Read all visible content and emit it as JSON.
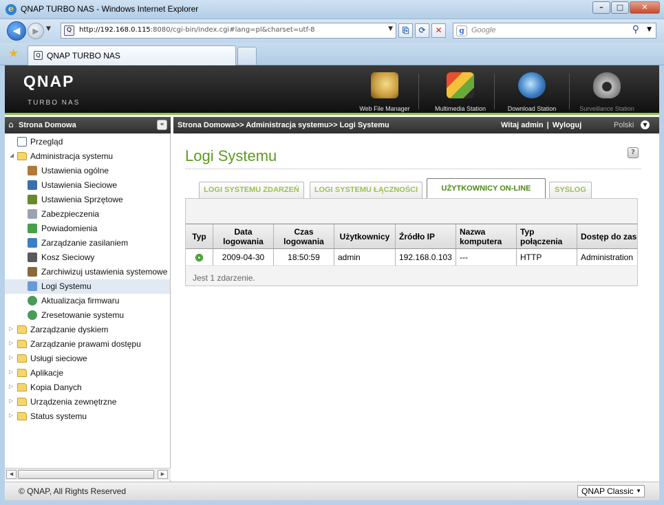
{
  "window": {
    "title": "QNAP TURBO NAS - Windows Internet Explorer"
  },
  "address": {
    "url_host": "http://192.168.0.115",
    "url_rest": ":8080/cgi-bin/index.cgi#lang=pl&charset=utf-8"
  },
  "search": {
    "placeholder": "Google"
  },
  "tabs": [
    {
      "label": "QNAP TURBO NAS"
    }
  ],
  "header": {
    "logo": "QNAP",
    "logo_sub": "TURBO NAS",
    "apps": [
      {
        "label": "Web File Manager",
        "icon": "web-file-manager-icon",
        "color": "#c89a3c"
      },
      {
        "label": "Multimedia Station",
        "icon": "multimedia-station-icon",
        "color": "#7a9e3a"
      },
      {
        "label": "Download Station",
        "icon": "download-station-icon",
        "color": "#3c7fc4"
      },
      {
        "label": "Surveillance Station",
        "icon": "surveillance-station-icon",
        "color": "#9a9a9a"
      }
    ]
  },
  "sidebar": {
    "title": "Strona Domowa",
    "items": [
      {
        "label": "Przegląd"
      },
      {
        "label": "Administracja systemu"
      },
      {
        "label": "Ustawienia ogólne"
      },
      {
        "label": "Ustawienia Sieciowe"
      },
      {
        "label": "Ustawienia Sprzętowe"
      },
      {
        "label": "Zabezpieczenia"
      },
      {
        "label": "Powiadomienia"
      },
      {
        "label": "Zarządzanie zasilaniem"
      },
      {
        "label": "Kosz Sieciowy"
      },
      {
        "label": "Zarchiwizuj ustawienia systemowe"
      },
      {
        "label": "Logi Systemu"
      },
      {
        "label": "Aktualizacja firmwaru"
      },
      {
        "label": "Zresetowanie systemu"
      },
      {
        "label": "Zarządzanie dyskiem"
      },
      {
        "label": "Zarządzanie prawami dostępu"
      },
      {
        "label": "Usługi sieciowe"
      },
      {
        "label": "Aplikacje"
      },
      {
        "label": "Kopia Danych"
      },
      {
        "label": "Urządzenia zewnętrzne"
      },
      {
        "label": "Status systemu"
      }
    ]
  },
  "crumb": {
    "path": "Strona Domowa>> Administracja systemu>> Logi Systemu",
    "welcome": "Witaj admin",
    "logout": "Wyloguj",
    "language": "Polski"
  },
  "main": {
    "title": "Logi Systemu",
    "help": "?",
    "tabs": [
      {
        "label": "LOGI SYSTEMU ZDARZEŃ"
      },
      {
        "label": "LOGI SYSTEMU ŁĄCZNOŚCI"
      },
      {
        "label": "UŻYTKOWNICY ON-LINE"
      },
      {
        "label": "SYSLOG"
      }
    ],
    "columns": [
      "Typ",
      "Data logowania",
      "Czas logowania",
      "Użytkownicy",
      "Źródło IP",
      "Nazwa komputera",
      "Typ połączenia",
      "Dostęp do zasobów"
    ],
    "rows": [
      {
        "type_icon": "online-status-icon",
        "date": "2009-04-30",
        "time": "18:50:59",
        "user": "admin",
        "ip": "192.168.0.103",
        "computer": "---",
        "conn": "HTTP",
        "access": "Administration"
      }
    ],
    "count": "Jest 1 zdarzenie."
  },
  "footer": {
    "copyright": "© QNAP, All Rights Reserved",
    "theme": "QNAP Classic"
  }
}
